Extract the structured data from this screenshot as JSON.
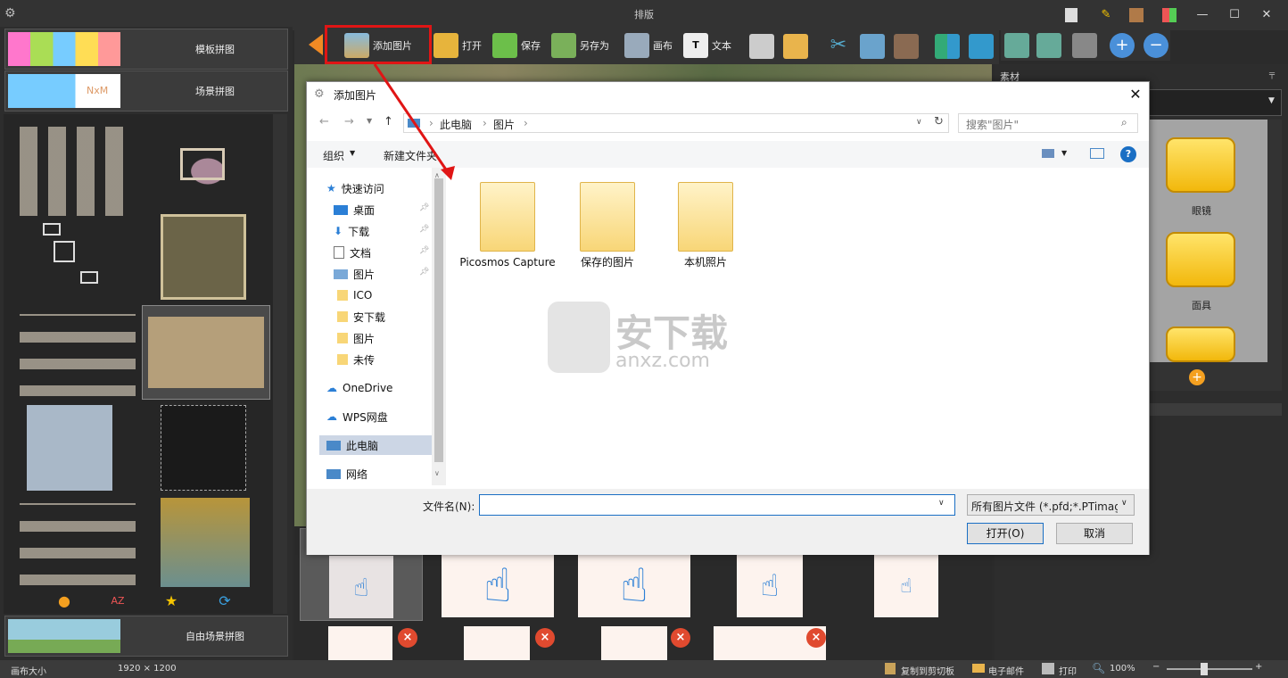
{
  "window": {
    "title": "排版"
  },
  "left_panel": {
    "template_collage": "模板拼图",
    "scene_collage": "场景拼图",
    "nxm": "NxM",
    "free_scene_collage": "自由场景拼图",
    "bottom_icons": [
      "add-icon",
      "sort-az-icon",
      "star-icon",
      "refresh-icon"
    ]
  },
  "toolbar": {
    "add_image": "添加图片",
    "open": "打开",
    "save": "保存",
    "save_as": "另存为",
    "canvas": "画布",
    "text": "文本"
  },
  "right_panel": {
    "title": "素材",
    "items": [
      {
        "label": "眼镜"
      },
      {
        "label": "面具"
      }
    ]
  },
  "dialog": {
    "title": "添加图片",
    "path": [
      "此电脑",
      "图片"
    ],
    "search_placeholder": "搜索\"图片\"",
    "organize": "组织",
    "new_folder": "新建文件夹",
    "nav": {
      "quick_access": "快速访问",
      "desktop": "桌面",
      "downloads": "下载",
      "documents": "文档",
      "pictures": "图片",
      "ico": "ICO",
      "anxiazai": "安下载",
      "pictures2": "图片",
      "weichuan": "未传",
      "onedrive": "OneDrive",
      "wps": "WPS网盘",
      "this_pc": "此电脑",
      "network": "网络"
    },
    "folders": [
      {
        "name": "Picosmos Capture"
      },
      {
        "name": "保存的图片"
      },
      {
        "name": "本机照片"
      }
    ],
    "filename_label": "文件名(N):",
    "filter": "所有图片文件 (*.pfd;*.PTimage",
    "open_btn": "打开(O)",
    "cancel_btn": "取消"
  },
  "watermark": {
    "cn": "安下载",
    "en": "anxz.com"
  },
  "status": {
    "canvas_size_label": "画布大小",
    "canvas_size": "1920 × 1200",
    "copy_clipboard": "复制到剪切板",
    "email": "电子邮件",
    "print": "打印",
    "zoom": "100%"
  }
}
